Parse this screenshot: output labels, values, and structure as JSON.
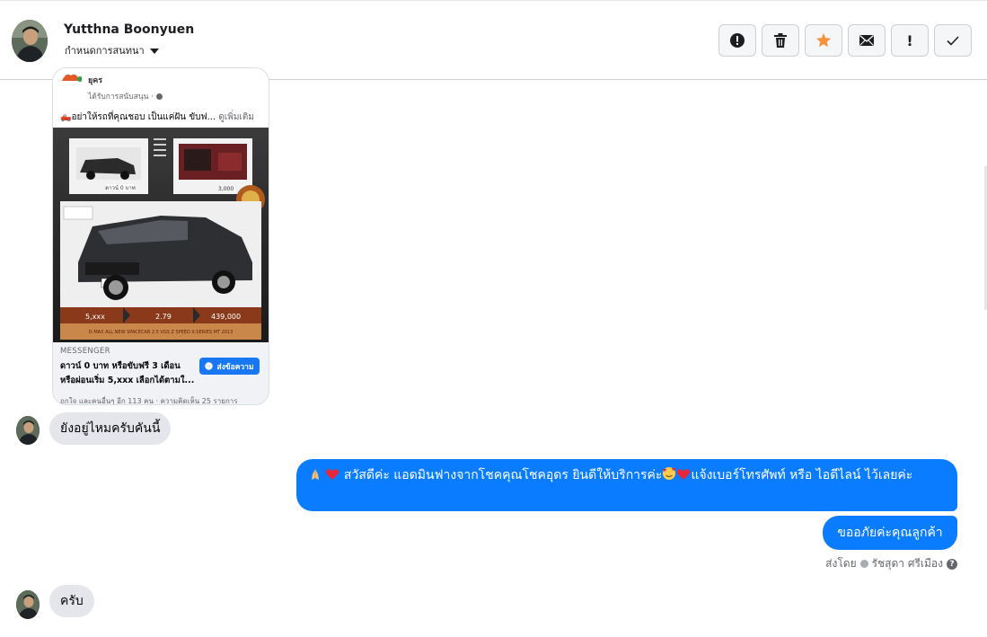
{
  "header": {
    "name": "Yutthna Boonyuen",
    "subtitle": "กำหนดการสนทนา",
    "actions": [
      {
        "icon": "alert-circle-icon"
      },
      {
        "icon": "trash-icon"
      },
      {
        "icon": "star-icon",
        "color": "#f7923a"
      },
      {
        "icon": "envelope-icon"
      },
      {
        "icon": "exclamation-icon",
        "text": "!"
      },
      {
        "icon": "checkmark-icon"
      }
    ]
  },
  "ad_card": {
    "page_name": "ยุคร",
    "sponsored": "ได้รับการสนับสนุน · ",
    "description": "🛻อย่าให้รถที่คุณชอบ เป็นแค่ฝัน ขับฟ...",
    "see_more": "ดูเพิ่มเติม",
    "image_texts": {
      "price_small": "ดาวน์ 0 บาท",
      "price_small2": "3,000",
      "badge_a": "5,xxx",
      "badge_b": "2.79",
      "badge_c": "439,000",
      "model": "D-MAX ALL NEW SPACECAB 2.5 VGS Z SPEED X-SERIES MT 2013"
    },
    "footer_label": "MESSENGER",
    "footer_title": "ดาวน์ 0 บาท หรือขับฟรี 3 เดือน หรือผ่อนเริ่ม 5,xxx เลือกได้ตามใ...",
    "button_label": "ส่งข้อความ",
    "footer_bottom": "ถูกใจ และคนอื่นๆ อีก 113 คน · ความคิดเห็น 25 รายการ"
  },
  "messages": [
    {
      "direction": "in",
      "text": "ยังอยู่ไหมครับคันนี้"
    },
    {
      "direction": "out",
      "text": "สวัสดีค่ะ แอดมินฟางจากโชคคุณโชคอุดร ยินดีให้บริการค่ะ",
      "text_after": "แจ้งเบอร์โทรศัพท์ หรือ ไอดีไลน์  ไว้เลยค่ะ"
    },
    {
      "direction": "out",
      "text": "ขออภัยค่ะคุณลูกค้า"
    },
    {
      "direction": "in",
      "text": "ครับ"
    }
  ],
  "sent_by": {
    "prefix": "ส่งโดย",
    "name": "รัชสุดา ศรีเมือง",
    "help": "?"
  },
  "colors": {
    "outgoing_bubble": "#0a7cff",
    "incoming_bubble": "#e4e6eb",
    "accent_star": "#f7923a"
  }
}
